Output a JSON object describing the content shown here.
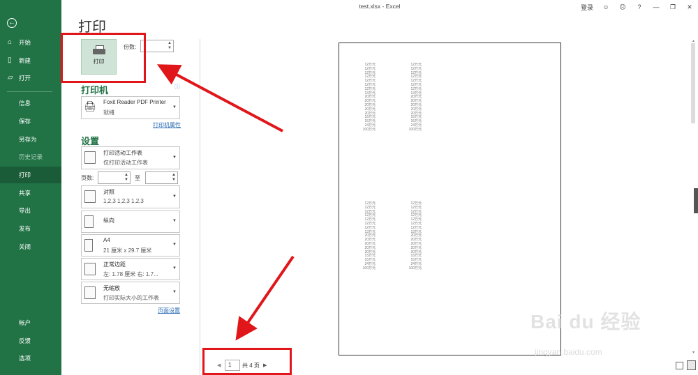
{
  "window": {
    "title": "test.xlsx  -  Excel",
    "login": "登录",
    "help": "?",
    "minimize": "—",
    "restore": "❐",
    "close": "✕"
  },
  "sidebar": {
    "back_icon": "←",
    "top_items": [
      {
        "label": "开始",
        "icon": "⌂"
      },
      {
        "label": "新建",
        "icon": "▯"
      },
      {
        "label": "打开",
        "icon": "▱"
      }
    ],
    "items": [
      "信息",
      "保存",
      "另存为",
      "历史记录",
      "打印",
      "共享",
      "导出",
      "发布",
      "关闭"
    ],
    "active": "打印",
    "bottom_items": [
      "帐户",
      "反馈",
      "选项"
    ]
  },
  "main": {
    "title": "打印",
    "print_button": "打印",
    "copies_label": "份数:",
    "printer_heading": "打印机",
    "printer": {
      "name": "Foxit Reader PDF Printer",
      "status": "就绪"
    },
    "printer_props_link": "打印机属性",
    "settings_heading": "设置",
    "settings": {
      "scope": {
        "l1": "打印活动工作表",
        "l2": "仅打印活动工作表"
      },
      "pages_label": "页数:",
      "to_label": "至",
      "collate": {
        "l1": "对照",
        "l2": "1,2,3    1,2,3    1,2,3"
      },
      "orientation": {
        "l1": "纵向"
      },
      "paper": {
        "l1": "A4",
        "l2": "21 厘米 x 29.7 厘米"
      },
      "margins": {
        "l1": "正常边距",
        "l2": "左: 1.78 厘米    右: 1.7..."
      },
      "scaling": {
        "l1": "无缩放",
        "l2": "打印实际大小的工作表"
      }
    },
    "page_setup_link": "页面设置"
  },
  "preview": {
    "col_values": [
      "12万元",
      "12万元",
      "12万元",
      "12万元",
      "12万元",
      "12万元",
      "12万元",
      "13万元",
      "20万元",
      "20万元",
      "20万元",
      "20万元",
      "20万元",
      "15万元",
      "15万元",
      "24万元",
      "100万元"
    ],
    "page_nav": {
      "current": "1",
      "total": "共 4 页",
      "prev": "◀",
      "next": "▶"
    }
  },
  "watermark": {
    "brand": "Bai du 经验",
    "url": "jingyan.baidu.com"
  },
  "colors": {
    "accent": "#217346",
    "annotation": "#e0161a"
  }
}
